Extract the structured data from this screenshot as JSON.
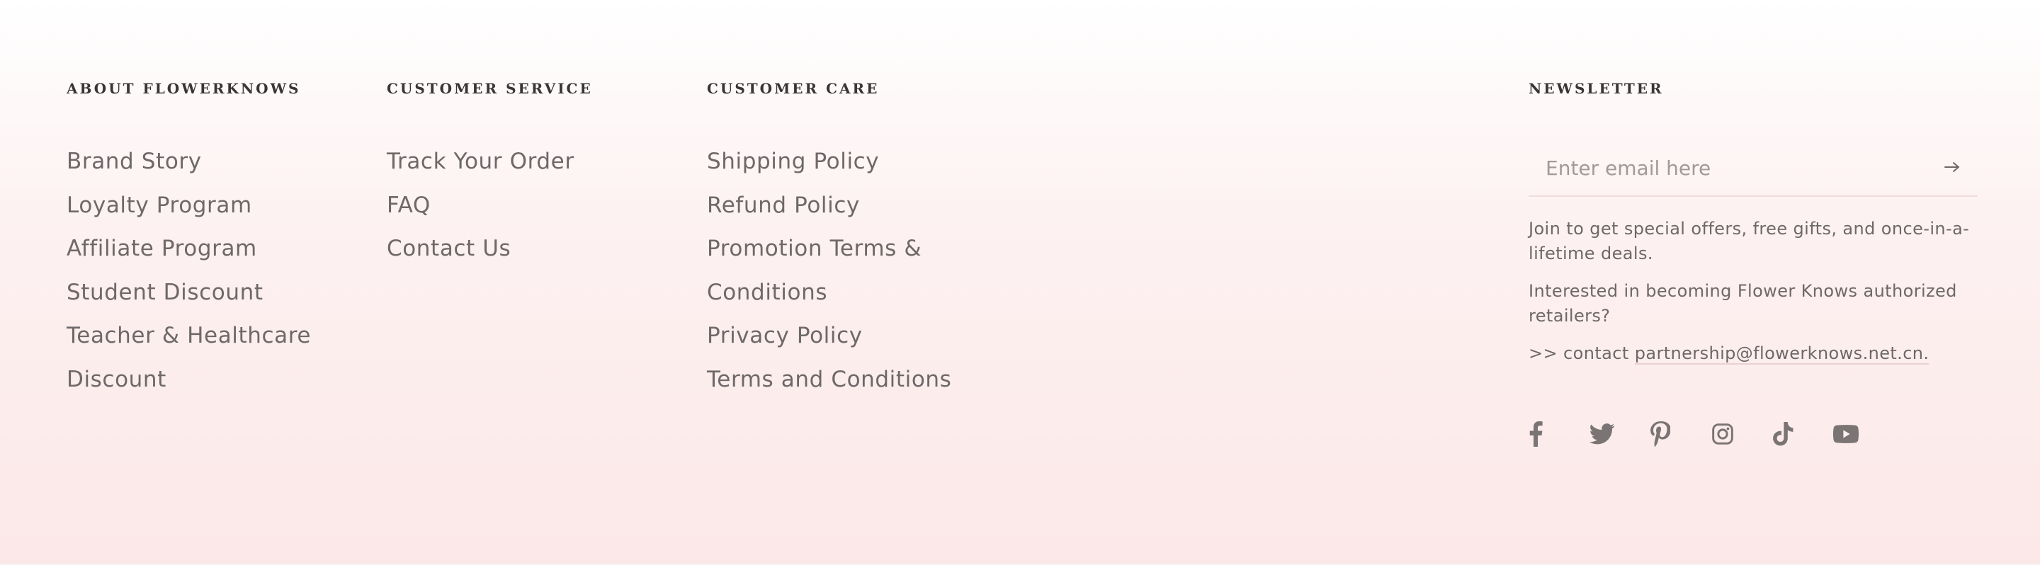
{
  "about": {
    "heading": "ABOUT FLOWERKNOWS",
    "links": [
      "Brand Story",
      "Loyalty Program",
      "Affiliate Program",
      "Student Discount",
      "Teacher & Healthcare",
      "Discount"
    ]
  },
  "service": {
    "heading": "CUSTOMER SERVICE",
    "links": [
      "Track Your Order",
      "FAQ",
      "Contact Us"
    ]
  },
  "care": {
    "heading": "CUSTOMER CARE",
    "links": [
      "Shipping Policy",
      "Refund Policy",
      "Promotion Terms &",
      "Conditions",
      "Privacy Policy",
      "Terms and Conditions"
    ]
  },
  "newsletter": {
    "heading": "NEWSLETTER",
    "placeholder": "Enter email here",
    "submit_icon": "arrow-right-icon",
    "text_1": "Join to get special offers, free gifts, and once-in-a-lifetime deals.",
    "text_2": "Interested in becoming Flower Knows authorized retailers?",
    "contact_prefix": ">> contact ",
    "contact_link": "partnership@flowerknows.net.cn."
  },
  "socials": [
    "facebook-icon",
    "twitter-icon",
    "pinterest-icon",
    "instagram-icon",
    "tiktok-icon",
    "youtube-icon"
  ],
  "colors": {
    "background_top": "#ffffff",
    "background_bottom": "#fce8e8",
    "heading": "#3a3535",
    "text": "#6e6868",
    "icon": "#7a7474"
  }
}
